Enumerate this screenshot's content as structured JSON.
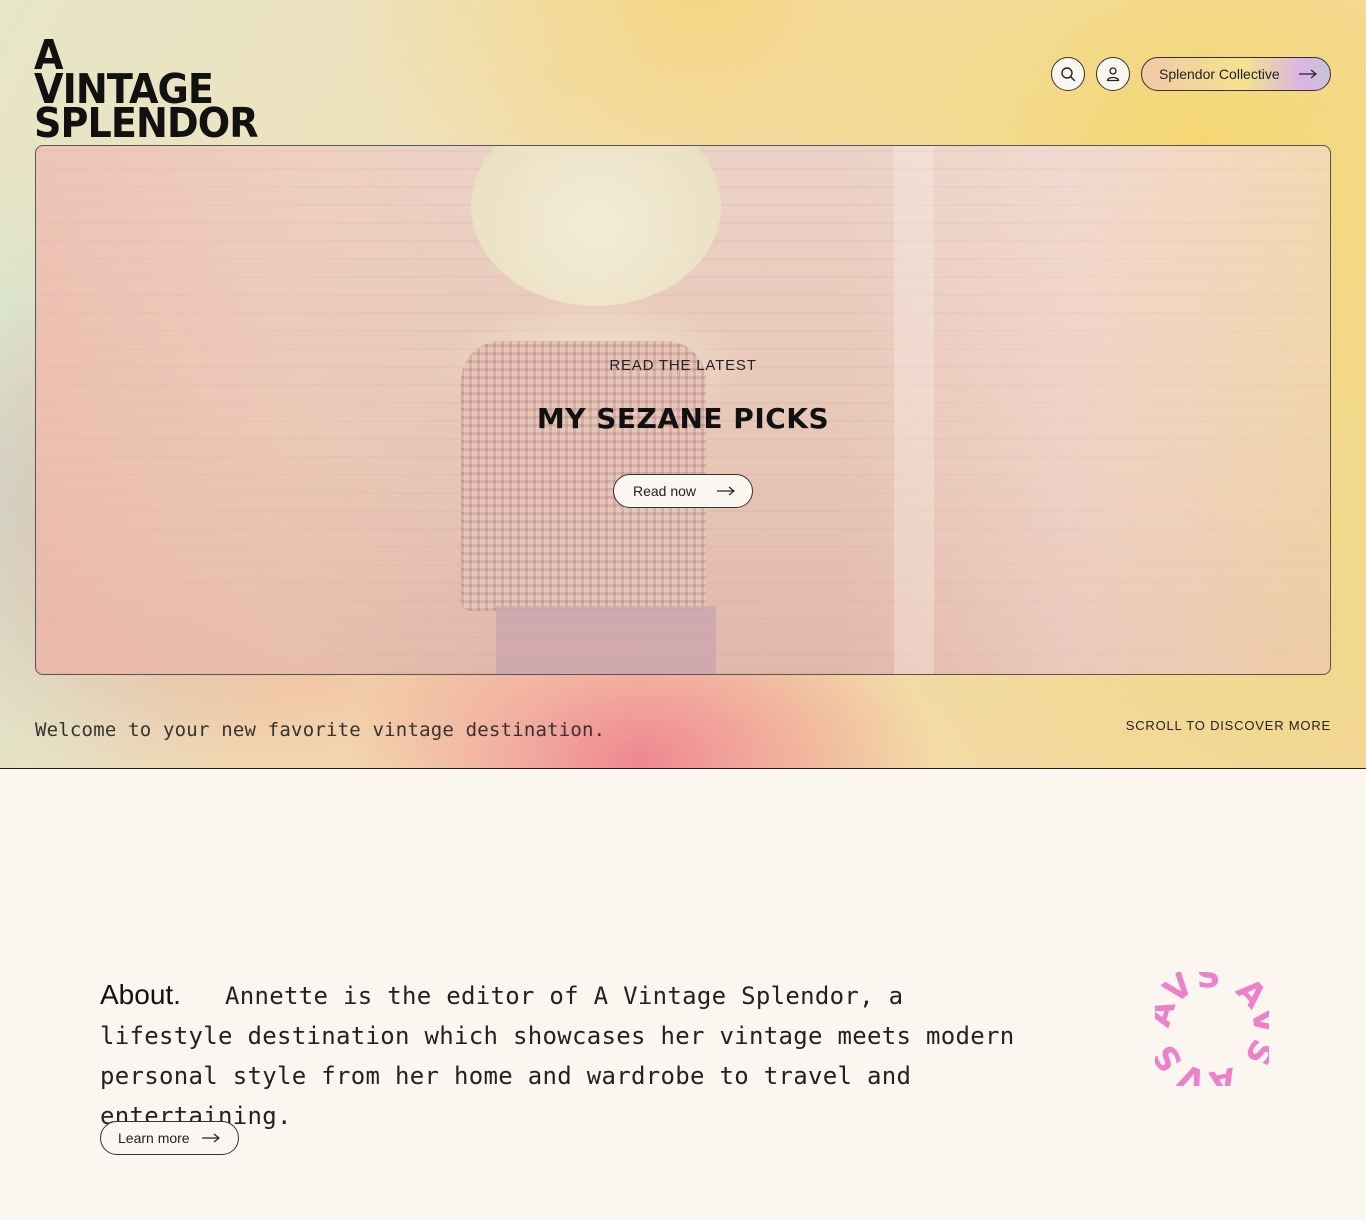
{
  "header": {
    "logo_line1": "A VINTAGE",
    "logo_line2": "SPLENDOR",
    "collective_label": "Splendor Collective"
  },
  "feature": {
    "eyebrow": "READ THE LATEST",
    "title": "MY SEZANE PICKS",
    "cta_label": "Read now"
  },
  "hero_footer": {
    "welcome": "Welcome to your new favorite vintage destination.",
    "scroll_hint": "SCROLL TO DISCOVER MORE"
  },
  "about": {
    "heading": "About.",
    "body": "Annette is the editor of A Vintage Splendor, a lifestyle destination which showcases her vintage meets modern personal style from her home and wardrobe to travel and entertaining.",
    "cta_label": "Learn more"
  },
  "badge": {
    "text": "AVS AVS AVS"
  },
  "colors": {
    "accent_pink": "#ee7fc8",
    "ink": "#111111",
    "cream": "#fbf7f0"
  },
  "icons": {
    "search": "search-icon",
    "account": "user-icon",
    "arrow": "arrow-right-icon"
  }
}
